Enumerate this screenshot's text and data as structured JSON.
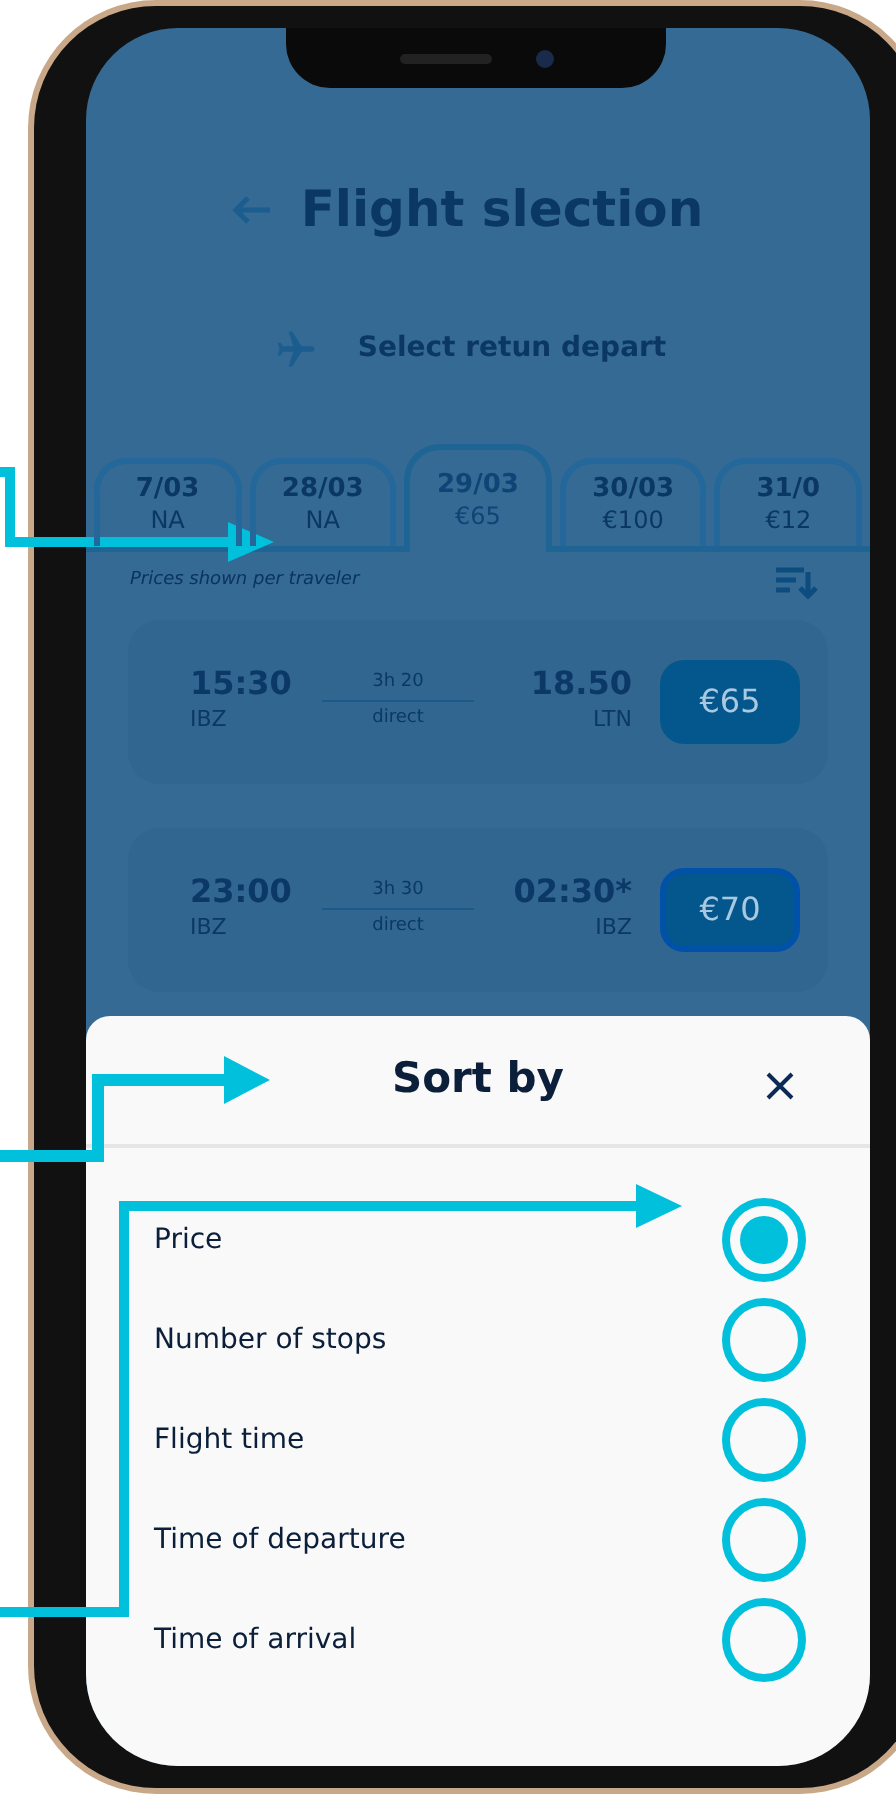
{
  "header": {
    "title": "Flight slection"
  },
  "subheader": {
    "text": "Select retun depart"
  },
  "date_tabs": [
    {
      "date": "7/03",
      "price": "NA",
      "selected": false
    },
    {
      "date": "28/03",
      "price": "NA",
      "selected": false
    },
    {
      "date": "29/03",
      "price": "€65",
      "selected": true
    },
    {
      "date": "30/03",
      "price": "€100",
      "selected": false
    },
    {
      "date": "31/0",
      "price": "€12",
      "selected": false
    }
  ],
  "price_note": "Prices shown per traveler",
  "flights": [
    {
      "departure_time": "15:30",
      "departure_airport": "IBZ",
      "duration": "3h 20",
      "stops": "direct",
      "arrival_time": "18.50",
      "arrival_airport": "LTN",
      "price": "€65",
      "selected": false
    },
    {
      "departure_time": "23:00",
      "departure_airport": "IBZ",
      "duration": "3h 30",
      "stops": "direct",
      "arrival_time": "02:30*",
      "arrival_airport": "IBZ",
      "price": "€70",
      "selected": true
    }
  ],
  "sort_sheet": {
    "title": "Sort by",
    "options": [
      {
        "label": "Price",
        "selected": true
      },
      {
        "label": "Number of stops",
        "selected": false
      },
      {
        "label": "Flight time",
        "selected": false
      },
      {
        "label": "Time of departure",
        "selected": false
      },
      {
        "label": "Time of arrival",
        "selected": false
      }
    ]
  }
}
